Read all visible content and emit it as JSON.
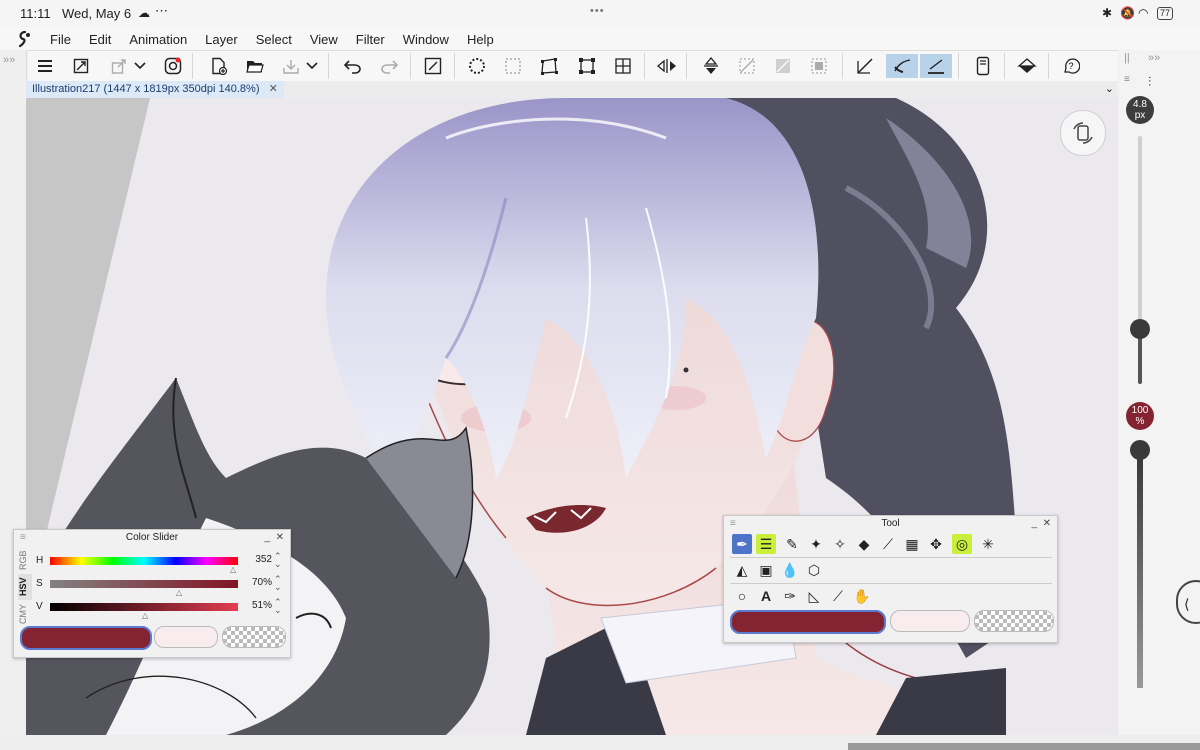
{
  "status": {
    "time": "11:11",
    "date": "Wed, May 6",
    "dots": "•••",
    "battery": "77"
  },
  "menu": [
    "File",
    "Edit",
    "Animation",
    "Layer",
    "Select",
    "View",
    "Filter",
    "Window",
    "Help"
  ],
  "document": {
    "tab_label": "Illustration217 (1447 x 1819px 350dpi 140.8%)",
    "close": "✕"
  },
  "brush": {
    "size_line1": "4.8",
    "size_line2": "px",
    "opacity_line1": "100",
    "opacity_line2": "%",
    "size_level": 0.22,
    "opacity_level": 1.0
  },
  "color_slider": {
    "title": "Color Slider",
    "modes": [
      "RGB",
      "HSV",
      "CMY"
    ],
    "active_mode": "HSV",
    "rows": [
      {
        "label": "H",
        "value": "352"
      },
      {
        "label": "S",
        "value": "70%"
      },
      {
        "label": "V",
        "value": "51%"
      }
    ],
    "main_color": "#842331",
    "sub_color": "#f8ecee"
  },
  "tool_panel": {
    "title": "Tool"
  },
  "colors": {
    "selected_tool": "#4d74c9",
    "highlight_tool": "#c8ef3a",
    "toolbar_active": "#b8d2ea"
  }
}
